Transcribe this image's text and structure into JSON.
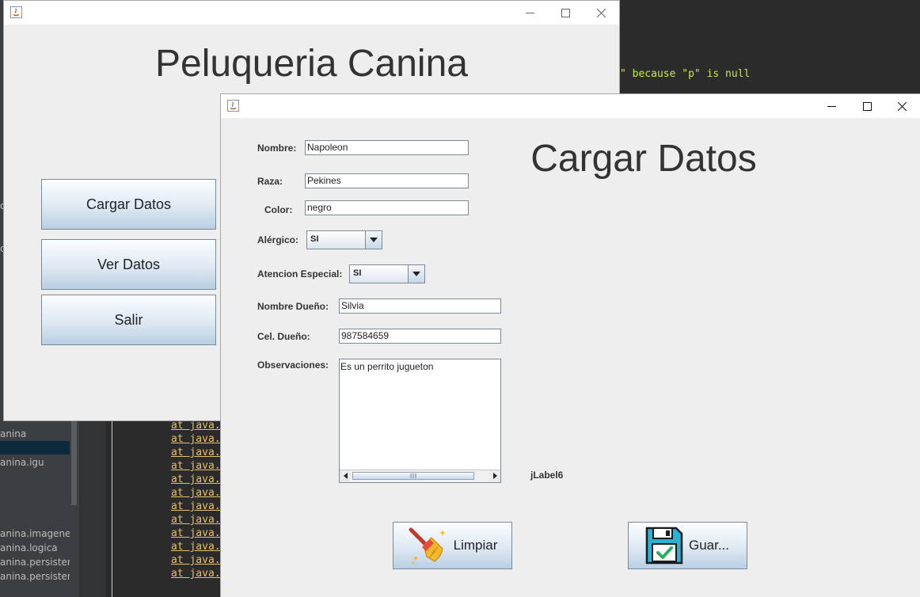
{
  "ide": {
    "console_message": "\" because \"p\" is null",
    "stack_line": "at java.",
    "stack_count": 12,
    "tree_items": [
      "anina",
      "",
      "anina.igu",
      "anina.imagenes",
      "anina.logica",
      "anina.persistenc",
      "anina.persistenc"
    ],
    "edge_glyphs": [
      "o",
      "o"
    ]
  },
  "main_window": {
    "title": "Peluqueria Canina",
    "buttons": {
      "cargar": "Cargar Datos",
      "ver": "Ver Datos",
      "salir": "Salir"
    }
  },
  "form_window": {
    "title": "Cargar Datos",
    "fields": {
      "nombre_label": "Nombre:",
      "nombre_value": "Napoleon",
      "raza_label": "Raza:",
      "raza_value": "Pekines",
      "color_label": "Color:",
      "color_value": "negro",
      "alergico_label": "Alérgico:",
      "alergico_value": "SI",
      "atencion_label": "Atencion Especial:",
      "atencion_value": "SI",
      "dueno_label": "Nombre Dueño:",
      "dueno_value": "Silvia",
      "cel_label": "Cel. Dueño:",
      "cel_value": "987584659",
      "obs_label": "Observaciones:",
      "obs_value": "Es un perrito jugueton"
    },
    "jlabel": "jLabel6",
    "buttons": {
      "limpiar": "Limpiar",
      "guardar": "Guar..."
    },
    "icons": {
      "limpiar": "broom-icon",
      "guardar": "save-disk-icon"
    }
  }
}
